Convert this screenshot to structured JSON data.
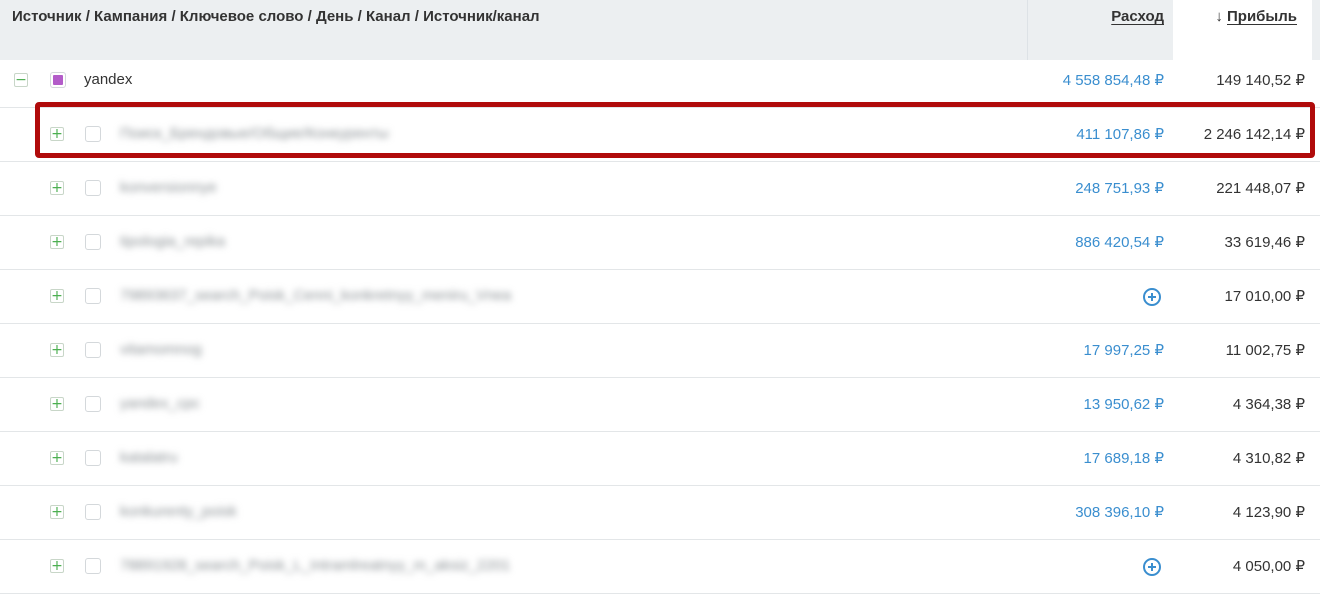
{
  "header": {
    "group_title": "Источник / Кампания / Ключевое слово / День / Канал / Источник/канал",
    "expense_label": "Расход",
    "profit_label": "Прибыль",
    "sort_icon": "↓"
  },
  "icons": {
    "expand": "+",
    "collapse": "−"
  },
  "colors": {
    "expense_link": "#3a8ecf",
    "toggle_green": "#4caf50",
    "checked_purple": "#b35cc9",
    "highlight_red": "#b00b0b",
    "header_bg": "#eceff1"
  },
  "rows": [
    {
      "name": "yandex",
      "expense": "4 558 854,48 ₽",
      "profit": "149 140,52 ₽"
    },
    {
      "name": "Поиск_Брендовые/Общие/Конкуренты",
      "expense": "411 107,86 ₽",
      "profit": "2 246 142,14 ₽"
    },
    {
      "name": "konversionnye",
      "expense": "248 751,93 ₽",
      "profit": "221 448,07 ₽"
    },
    {
      "name": "tipologia_repika",
      "expense": "886 420,54 ₽",
      "profit": "33 619,46 ₽"
    },
    {
      "name": "79893637_search_Poisk_Cenni_konkretnyy_meniru_Vnea",
      "expense": "",
      "profit": "17 010,00 ₽"
    },
    {
      "name": "vitamomnog",
      "expense": "17 997,25 ₽",
      "profit": "11 002,75 ₽"
    },
    {
      "name": "yandex_cpc",
      "expense": "13 950,62 ₽",
      "profit": "4 364,38 ₽"
    },
    {
      "name": "katalatru",
      "expense": "17 689,18 ₽",
      "profit": "4 310,82 ₽"
    },
    {
      "name": "konkurenty_poisk",
      "expense": "308 396,10 ₽",
      "profit": "4 123,90 ₽"
    },
    {
      "name": "78891928_search_Poisk_L_Intramlreatnyy_m_aksiz_2201",
      "expense": "",
      "profit": "4 050,00 ₽"
    }
  ]
}
